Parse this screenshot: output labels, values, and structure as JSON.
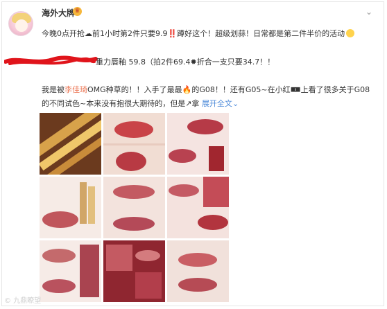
{
  "post": {
    "author": "海外大牌",
    "line1": "今晚0点开抢☁前1小时第2件只要9.9‼️蹲好这个！超级划蒜！日常都是第二件半价的活动",
    "line2": "重力唇釉 59.8（拍2件69.4✹折合一支只要34.7！！",
    "line3_pre": "我是被",
    "line3_link": "李佳琦",
    "line3_post": "OMG种草的！！入手了最最🔥的G08！！还有G05~在小红🀰上看了很多关于G08",
    "line4_pre": "的不同试色~本来没有抱很大期待的，但是↗拿",
    "line4_more": "展开全文",
    "line4_chevron": "⌄"
  },
  "icons": {
    "menu": "chevron-down-icon",
    "badge": "crown-icon",
    "emoji": "smile-icon"
  },
  "colors": {
    "accent": "#eb7350",
    "link": "#4d8ad9"
  },
  "watermark": "© 九鼎瞭望"
}
